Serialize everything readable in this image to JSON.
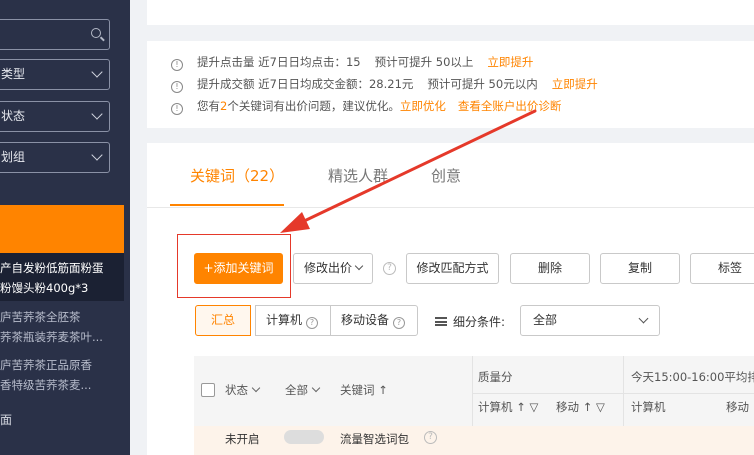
{
  "sidebar": {
    "fields": [
      {
        "label": ""
      },
      {
        "label": "类型"
      },
      {
        "label": "状态"
      },
      {
        "label": "划组"
      }
    ],
    "selected_item": [
      "产自发粉低筋面粉蛋",
      "粉馒头粉400g*3"
    ],
    "items": [
      [
        "庐苦荞茶全胚茶",
        "荞茶瓶装荞麦茶叶..."
      ],
      [
        "庐苦荞茶正品原香",
        "香特级苦荞茶麦..."
      ]
    ],
    "bottom_label": "面"
  },
  "tips": {
    "row1": {
      "prefix": "提升点击量 近7日日均点击：15",
      "forecast": "预计可提升 50以上",
      "link": "立即提升"
    },
    "row2": {
      "prefix": "提升成交额 近7日日均成交金额：28.21元",
      "forecast": "预计可提升 50元以内",
      "link": "立即提升"
    },
    "row3": {
      "prefix": "您有",
      "count": "2",
      "suffix": "个关键词有出价问题，建议优化。",
      "link1": "立即优化",
      "link2": "查看全账户出价诊断"
    }
  },
  "tabs": [
    {
      "label": "关键词（22）",
      "active": true
    },
    {
      "label": "精选人群",
      "active": false
    },
    {
      "label": "创意",
      "active": false
    }
  ],
  "toolbar": {
    "add_keyword": "+添加关键词",
    "modify_bid": "修改出价",
    "modify_match": "修改匹配方式",
    "delete": "删除",
    "copy": "复制",
    "tag": "标签"
  },
  "segments": [
    {
      "label": "汇总",
      "active": true
    },
    {
      "label": "计算机",
      "active": false
    },
    {
      "label": "移动设备",
      "active": false
    }
  ],
  "filter": {
    "label": "细分条件:",
    "value": "全部"
  },
  "table": {
    "status_header": "状态",
    "all_header": "全部",
    "keyword_header": "关键词 ↑",
    "quality_header": "质量分",
    "quality_sub": [
      "计算机 ↑ ▽",
      "移动 ↑ ▽"
    ],
    "rank_header": "今天15:00-16:00平均排",
    "rank_sub": [
      "计算机",
      "移动"
    ]
  },
  "row1": {
    "status": "未开启",
    "keyword": "流量智选词包",
    "help": "?"
  },
  "colors": {
    "accent": "#ff8400",
    "sidebar_bg": "#2a3148",
    "annotation": "#e5392a"
  }
}
